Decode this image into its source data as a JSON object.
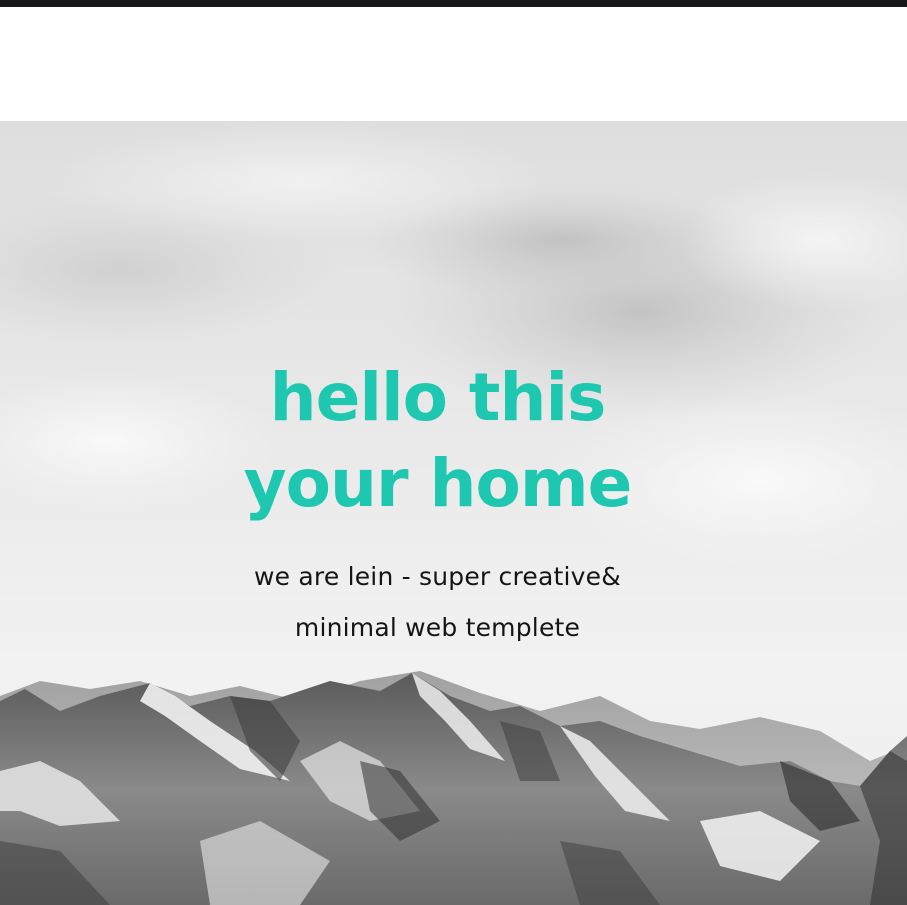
{
  "hero": {
    "headline_line1": "hello this",
    "headline_line2": "your home",
    "tagline_line1": "we are lein - super creative&",
    "tagline_line2": "minimal web templete",
    "background_image": "mountain-landscape"
  },
  "colors": {
    "accent": "#1ec8b0",
    "topbar": "#17171b",
    "text": "#151515"
  }
}
